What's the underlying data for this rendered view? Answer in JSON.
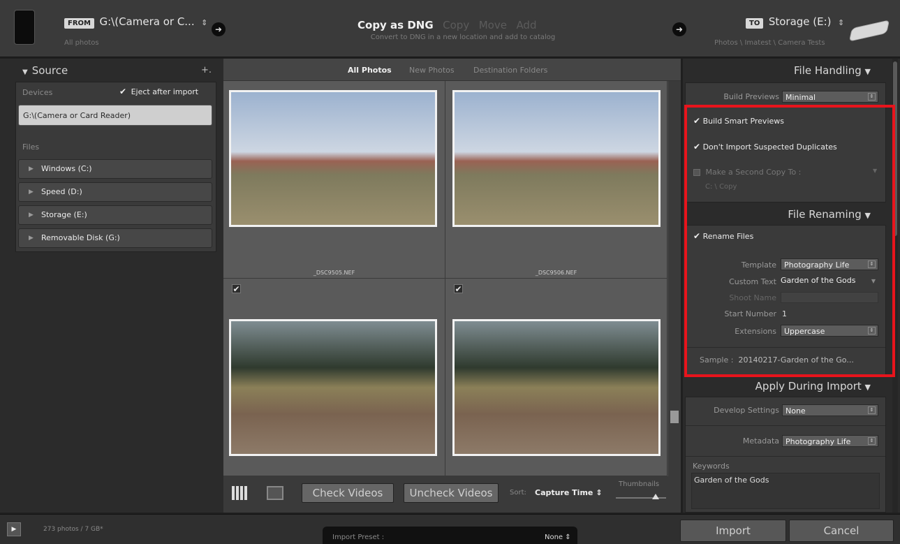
{
  "top": {
    "from_tag": "FROM",
    "source_path": "G:\\(Camera or C...",
    "source_sub": "All photos",
    "title": "Copy as DNG",
    "modes": [
      "Copy",
      "Move",
      "Add"
    ],
    "subtitle": "Convert to DNG in a new location and add to catalog",
    "to_tag": "TO",
    "dest": "Storage (E:)",
    "dest_path": "Photos \\ Imatest \\ Camera Tests"
  },
  "source": {
    "header": "Source",
    "plus": "+.",
    "devices_label": "Devices",
    "eject_label": "Eject after import",
    "device": "G:\\(Camera or Card Reader)",
    "files_label": "Files",
    "drives": [
      "Windows (C:)",
      "Speed (D:)",
      "Storage (E:)",
      "Removable Disk (G:)"
    ]
  },
  "grid": {
    "tabs": [
      "All Photos",
      "New Photos",
      "Destination Folders"
    ],
    "files": [
      "_DSC9505.NEF",
      "_DSC9506.NEF"
    ],
    "check_videos": "Check Videos",
    "uncheck_videos": "Uncheck Videos",
    "sort_label": "Sort:",
    "sort_value": "Capture Time",
    "thumbnails_label": "Thumbnails"
  },
  "file_handling": {
    "header": "File Handling",
    "build_previews_label": "Build Previews",
    "build_previews_value": "Minimal",
    "smart_previews": "Build Smart Previews",
    "no_duplicates": "Don't Import Suspected Duplicates",
    "second_copy": "Make a Second Copy To :",
    "second_copy_path": "C: \\ Copy"
  },
  "file_renaming": {
    "header": "File Renaming",
    "rename_files": "Rename Files",
    "template_label": "Template",
    "template_value": "Photography Life",
    "custom_text_label": "Custom Text",
    "custom_text_value": "Garden of the Gods",
    "shoot_name_label": "Shoot Name",
    "start_number_label": "Start Number",
    "start_number_value": "1",
    "extensions_label": "Extensions",
    "extensions_value": "Uppercase",
    "sample_label": "Sample :",
    "sample_value": "20140217-Garden of the Go..."
  },
  "apply": {
    "header": "Apply During Import",
    "develop_label": "Develop Settings",
    "develop_value": "None",
    "metadata_label": "Metadata",
    "metadata_value": "Photography Life",
    "keywords_label": "Keywords",
    "keywords_value": "Garden of the Gods"
  },
  "bottom": {
    "count": "273 photos / 7 GB*",
    "preset_label": "Import Preset :",
    "preset_value": "None",
    "import": "Import",
    "cancel": "Cancel"
  },
  "colors": {
    "highlight": "#e8141c"
  }
}
